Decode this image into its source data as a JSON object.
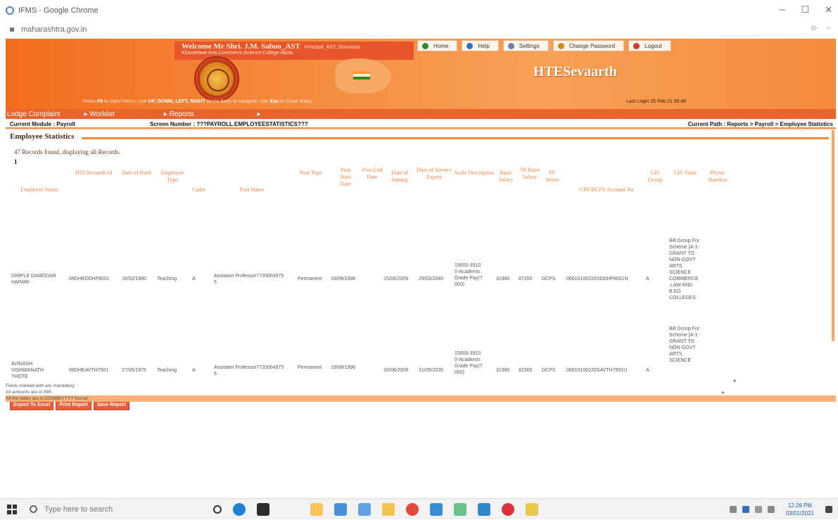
{
  "browser": {
    "window_title": "IFMS - Google Chrome",
    "url": "maharashtra.gov.in"
  },
  "header": {
    "welcome": "Welcome Mr Shri. J.M. Saboo_AST",
    "role": "Principal_AST, Shankarla",
    "institution": "Khandelwal Arts,Commerce,Science College Akola",
    "brand": "HTESevaarth",
    "nav": [
      {
        "label": "Home",
        "icon": "home-icon",
        "color": "#2e8b2e"
      },
      {
        "label": "Help",
        "icon": "help-icon",
        "color": "#2f6fc4"
      },
      {
        "label": "Settings",
        "icon": "settings-icon",
        "color": "#6e7ea8"
      },
      {
        "label": "Change Password",
        "icon": "key-icon",
        "color": "#d48a1a"
      },
      {
        "label": "Logout",
        "icon": "logout-icon",
        "color": "#d23a2a"
      }
    ],
    "hint_prefix": "Press ",
    "hint_key1": "F8",
    "hint_mid1": " to Open Menu. Use ",
    "hint_keys": "UP, DOWN, LEFT, RIGHT",
    "hint_mid2": " Arrow Keys to navigate. Use ",
    "hint_key3": "Esc",
    "hint_suffix": " to Close Menu.",
    "last_login": "Last Login 25 Feb 21 00:40"
  },
  "menu": {
    "items": [
      "Lodge Complaint",
      "▸ Worklist",
      "▸ Reports",
      "▸"
    ]
  },
  "pathbar": {
    "module": "Current Module : Payroll",
    "screen": "Screen Number : ???PAYROLL.EMPLOYEESTATISTICS???",
    "path": "Current Path : Reports  > Payroll > Employee Statistics"
  },
  "page": {
    "section_title": "Employee Statistics",
    "records": "47 Records found, displaying all Records.",
    "page_number": "1"
  },
  "table": {
    "headers": [
      "Employee Name",
      "HTESevaarth Id",
      "Date of Birth",
      "Employee Type",
      "Cadre",
      "Post Name",
      "Post Type",
      "Post Start Date",
      "Post End Date",
      "Date of Joining",
      "Date of Service Expiry",
      "Scale Description",
      "Basic Salary",
      "7th Basic Salary",
      "PF Series",
      "GPF/DCPS Account No",
      "GIS Group",
      "GIS Value",
      "Physic Handica"
    ],
    "rows": [
      {
        "name": "DIMPLE DAMODAR HAPARI",
        "sevaarth_id": "06DHEDDHF8001",
        "dob": "18/02/1980",
        "emp_type": "Teaching",
        "cadre": "A",
        "post_name": "Assistant Professor77200049755",
        "post_type": "Permanent",
        "post_start": "19/08/1998",
        "post_end": "",
        "doj": "15/06/2009",
        "doe": "29/02/2040",
        "scale": "15600-39100-Academic Grade Pay(7000)",
        "basic": "31980",
        "basic7": "87200",
        "pf_series": "DCPS",
        "gpf_no": "06610100220SDDHF8001N",
        "gis_group": "A",
        "gis_value": "Bill Group For Scheme [A-1-GRANT TO NON-GOVT ARTS SCIENCE COMMERCE ,LAW AND B.ED COLLEGES"
      },
      {
        "name": "AVINASH VISHWANATH THOTE",
        "sevaarth_id": "06DHEAVTH7501",
        "dob": "27/05/1975",
        "emp_type": "Teaching",
        "cadre": "A",
        "post_name": "Assistant Professor77200049756",
        "post_type": "Permanent",
        "post_start": "19/08/1998",
        "post_end": "",
        "doj": "16/06/2009",
        "doe": "31/05/2035",
        "scale": "15600-39100-Academic Grade Pay(7000)",
        "basic": "31980",
        "basic7": "82300",
        "pf_series": "DCPS",
        "gpf_no": "06610100220SAVTH7501U",
        "gis_group": "A",
        "gis_value": "Bill Group For Scheme [A-1-GRANT TO NON-GOVT ARTS SCIENCE"
      }
    ]
  },
  "actions": {
    "export": "Export To Excel",
    "print": "Print Report",
    "save": "Save Report"
  },
  "notes": [
    "Fields marked with    are mandatory.",
    "All amounts are in INR",
    "All the dates are in DD/MM/YYYY format"
  ],
  "taskbar": {
    "search_placeholder": "Type here to search",
    "time": "12:26 PM",
    "date": "03/01/2021"
  }
}
